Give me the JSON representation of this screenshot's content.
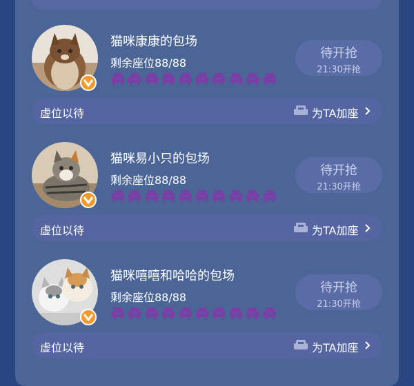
{
  "colors": {
    "background": "#2a4680",
    "panel": "#4c6597",
    "bar": "#5565a2",
    "seat": "#7a3fa6",
    "badge": "#f29b2c"
  },
  "cards": [
    {
      "title": "猫咪康康的包场",
      "seats_text": "剩余座位88/88",
      "status": "待开抢",
      "status_time": "21:30开抢",
      "waiting_label": "虚位以待",
      "add_seat_label": "为TA加座",
      "avatar_icon": "cat-avatar-icon"
    },
    {
      "title": "猫咪易小只的包场",
      "seats_text": "剩余座位88/88",
      "status": "待开抢",
      "status_time": "21:30开抢",
      "waiting_label": "虚位以待",
      "add_seat_label": "为TA加座",
      "avatar_icon": "cat-avatar-icon"
    },
    {
      "title": "猫咪嘻嘻和哈哈的包场",
      "seats_text": "剩余座位88/88",
      "status": "待开抢",
      "status_time": "21:30开抢",
      "waiting_label": "虚位以待",
      "add_seat_label": "为TA加座",
      "avatar_icon": "cats-avatar-icon"
    }
  ]
}
